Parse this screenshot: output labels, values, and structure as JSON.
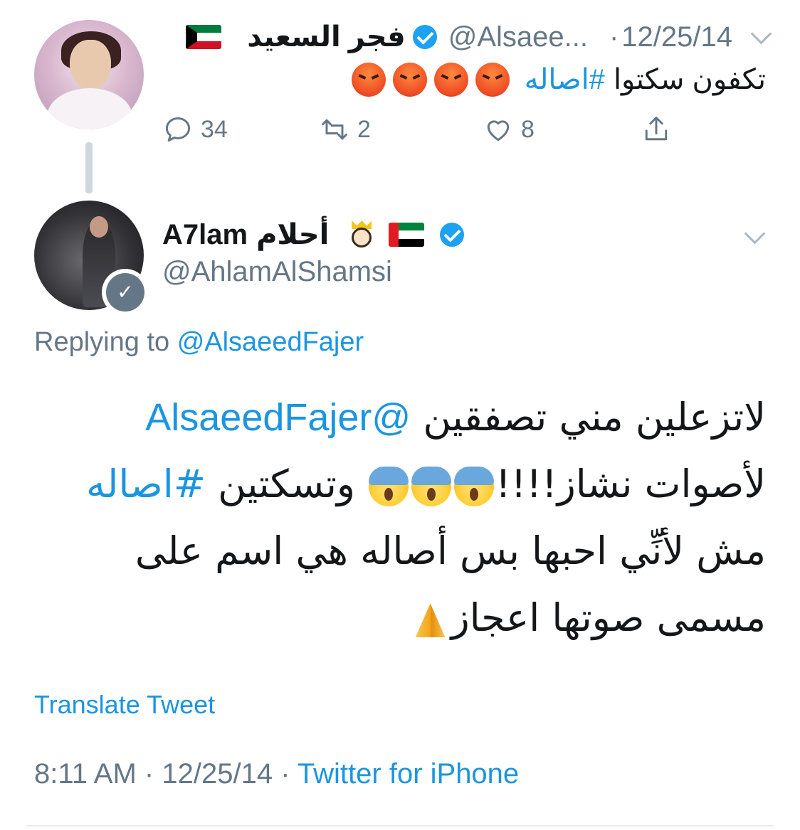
{
  "parent_tweet": {
    "name": "فجر السعيد",
    "handle": "@Alsaee...",
    "date": "12/25/14",
    "separator": "·",
    "text": "تكفون سكتوا",
    "hashtag": "#اصاله",
    "emoji": [
      "pouting-face",
      "pouting-face",
      "pouting-face",
      "pouting-face"
    ],
    "reply_count": "34",
    "retweet_count": "2",
    "like_count": "8",
    "flag": "kuwait-flag-icon"
  },
  "main_tweet": {
    "name_latin": "A7lam",
    "name_arabic": "أحلام",
    "handle": "@AhlamAlShamsi",
    "replying_prefix": "Replying to",
    "replying_handle": "@AlsaeedFajer",
    "body": {
      "line1_mention": "@AlsaeedFajer",
      "line1_text": "لاتزعلين مني تصفقين",
      "line2_text_a": "لأصوات نشاز!!!!",
      "line2_text_b": "وتسكتين",
      "line2_hashtag": "#اصاله",
      "line3_text": "مش لأنِّي احبها بس أصاله هي اسم على",
      "line4_text": "مسمى صوتها اعجاز"
    },
    "translate_label": "Translate Tweet",
    "time": "8:11 AM",
    "date": "12/25/14",
    "separator": "·",
    "source": "Twitter for iPhone"
  },
  "colors": {
    "link_blue": "#1b95e0",
    "muted_gray": "#657786",
    "verified_blue": "#1da1f2"
  }
}
